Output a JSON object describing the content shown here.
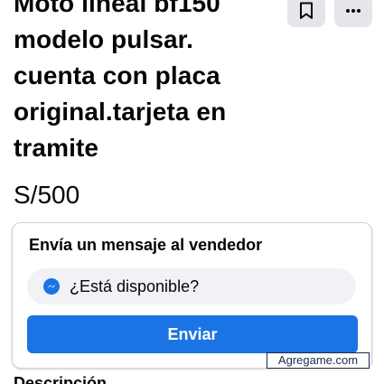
{
  "listing": {
    "title": "Moto lineal bf150 modelo pulsar. cuenta con placa original.tarjeta en tramite",
    "price": "S/500"
  },
  "actions": {
    "save_icon": "bookmark-icon",
    "more_icon": "more-options-icon"
  },
  "message_card": {
    "heading": "Envía un mensaje al vendedor",
    "message_value": "¿Está disponible?",
    "messenger_icon": "messenger-icon",
    "send_label": "Enviar"
  },
  "watermark": {
    "text": "Agregame.com"
  },
  "details": {
    "heading": "Descripción"
  },
  "colors": {
    "accent": "#1b74e4",
    "icon_bg": "#e4e6eb",
    "field_bg": "#f0f2f5",
    "text": "#050505"
  }
}
